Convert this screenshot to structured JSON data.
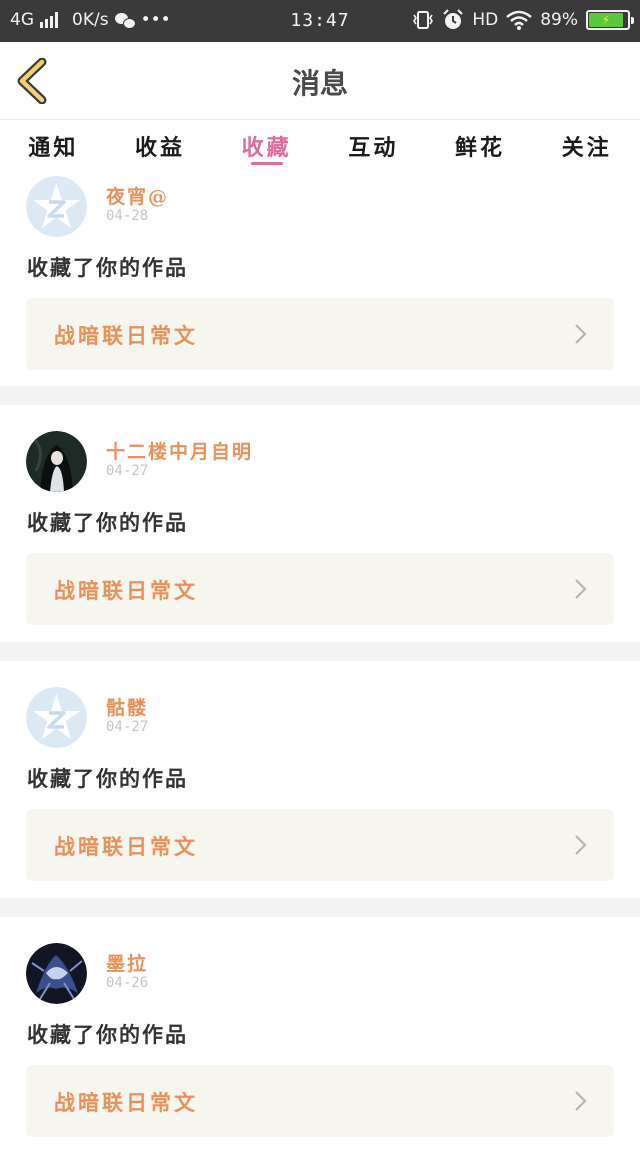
{
  "status_bar": {
    "network": "4G",
    "speed": "0K/s",
    "more": "•••",
    "time": "13:47",
    "hd": "HD",
    "battery_text": "89%",
    "battery_level": 0.89,
    "charging_symbol": "⚡"
  },
  "header": {
    "title": "消息",
    "back_icon": "chevron-left-icon"
  },
  "tabs": [
    {
      "label": "通知",
      "active": false
    },
    {
      "label": "收益",
      "active": false
    },
    {
      "label": "收藏",
      "active": true
    },
    {
      "label": "互动",
      "active": false
    },
    {
      "label": "鲜花",
      "active": false
    },
    {
      "label": "关注",
      "active": false
    }
  ],
  "colors": {
    "accent": "#e06b98",
    "username": "#e9915a",
    "work_bg": "#f6f5ee",
    "divider": "#f3f3f3"
  },
  "feed": [
    {
      "username": "夜宵@",
      "date": "04-28",
      "action": "收藏了你的作品",
      "work_title": "战暗联日常文",
      "avatar": "qq-default-avatar"
    },
    {
      "username": "十二楼中月自明",
      "date": "04-27",
      "action": "收藏了你的作品",
      "work_title": "战暗联日常文",
      "avatar": "dark-hair-character-avatar"
    },
    {
      "username": "骷髅",
      "date": "04-27",
      "action": "收藏了你的作品",
      "work_title": "战暗联日常文",
      "avatar": "qq-default-avatar"
    },
    {
      "username": "墨拉",
      "date": "04-26",
      "action": "收藏了你的作品",
      "work_title": "战暗联日常文",
      "avatar": "blue-armor-character-avatar"
    }
  ]
}
